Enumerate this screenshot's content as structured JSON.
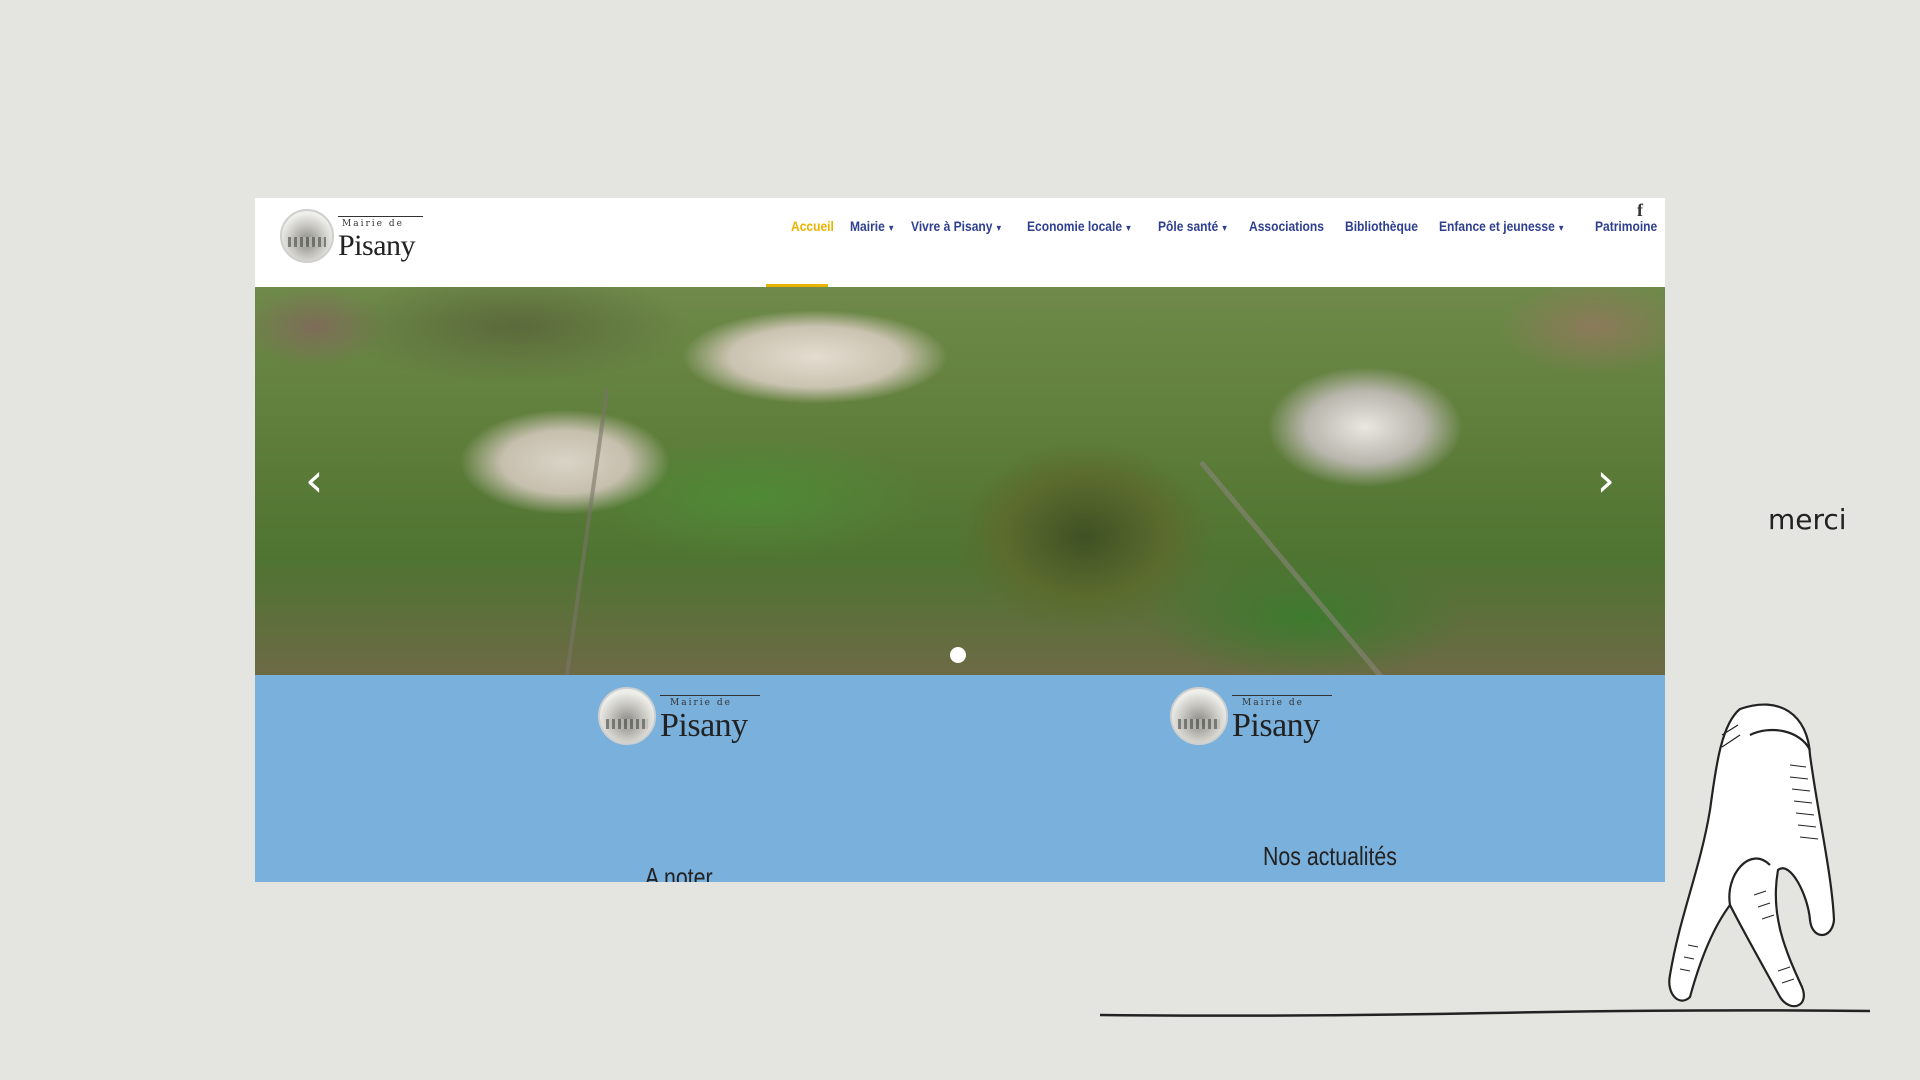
{
  "site": {
    "logo": {
      "small": "Mairie de",
      "big": "Pisany"
    },
    "nav": [
      {
        "label": "Accueil",
        "active": true,
        "dropdown": false
      },
      {
        "label": "Mairie",
        "active": false,
        "dropdown": true
      },
      {
        "label": "Vivre à Pisany",
        "active": false,
        "dropdown": true
      },
      {
        "label": "Economie locale",
        "active": false,
        "dropdown": true
      },
      {
        "label": "Pôle santé",
        "active": false,
        "dropdown": true
      },
      {
        "label": "Associations",
        "active": false,
        "dropdown": false
      },
      {
        "label": "Bibliothèque",
        "active": false,
        "dropdown": false
      },
      {
        "label": "Enfance et jeunesse",
        "active": false,
        "dropdown": true
      },
      {
        "label": "Patrimoine",
        "active": false,
        "dropdown": false
      }
    ],
    "social_icon": "facebook-icon",
    "slider": {
      "prev_icon": "chevron-left-icon",
      "next_icon": "chevron-right-icon",
      "slides": 1,
      "current": 1
    },
    "sections": [
      {
        "logo_small": "Mairie de",
        "logo_big": "Pisany",
        "title": "A noter"
      },
      {
        "logo_small": "Mairie de",
        "logo_big": "Pisany",
        "title": "Nos actualités"
      }
    ]
  },
  "slide_caption": "merci",
  "colors": {
    "background": "#e4e4e1",
    "nav_text": "#2f3f8f",
    "nav_active": "#e9b400",
    "section_blue": "#7ab0dc"
  }
}
